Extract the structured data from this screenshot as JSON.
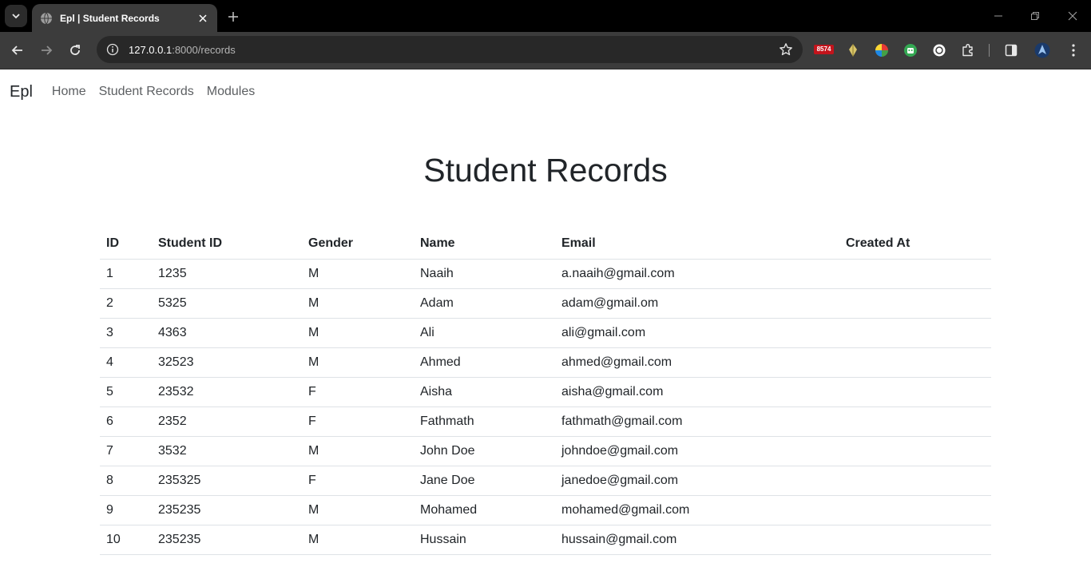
{
  "browser": {
    "tab_title": "Epl | Student Records",
    "url_host": "127.0.0.1",
    "url_rest": ":8000/records",
    "extension_badge": "8574"
  },
  "nav": {
    "brand": "Epl",
    "links": [
      "Home",
      "Student Records",
      "Modules"
    ]
  },
  "page": {
    "title": "Student Records"
  },
  "table": {
    "headers": [
      "ID",
      "Student ID",
      "Gender",
      "Name",
      "Email",
      "Created At"
    ],
    "rows": [
      [
        "1",
        "1235",
        "M",
        "Naaih",
        "a.naaih@gmail.com",
        ""
      ],
      [
        "2",
        "5325",
        "M",
        "Adam",
        "adam@gmail.om",
        ""
      ],
      [
        "3",
        "4363",
        "M",
        "Ali",
        "ali@gmail.com",
        ""
      ],
      [
        "4",
        "32523",
        "M",
        "Ahmed",
        "ahmed@gmail.com",
        ""
      ],
      [
        "5",
        "23532",
        "F",
        "Aisha",
        "aisha@gmail.com",
        ""
      ],
      [
        "6",
        "2352",
        "F",
        "Fathmath",
        "fathmath@gmail.com",
        ""
      ],
      [
        "7",
        "3532",
        "M",
        "John Doe",
        "johndoe@gmail.com",
        ""
      ],
      [
        "8",
        "235325",
        "F",
        "Jane Doe",
        "janedoe@gmail.com",
        ""
      ],
      [
        "9",
        "235235",
        "M",
        "Mohamed",
        "mohamed@gmail.com",
        ""
      ],
      [
        "10",
        "235235",
        "M",
        "Hussain",
        "hussain@gmail.com",
        ""
      ]
    ]
  },
  "colors": {
    "chrome_dark": "#000000",
    "chrome_toolbar": "#3c3c3c",
    "text": "#212529",
    "nav_link": "#5c5f62",
    "row_border": "#dee2e6"
  }
}
